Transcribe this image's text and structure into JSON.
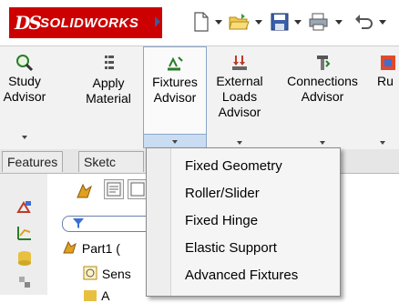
{
  "app": {
    "logo_text": "SOLIDWORKS",
    "logo_mark": "DS"
  },
  "quick_access": [
    {
      "icon": "new-document-icon"
    },
    {
      "icon": "open-folder-icon"
    },
    {
      "icon": "save-icon"
    },
    {
      "icon": "print-icon"
    }
  ],
  "ribbon": {
    "buttons": [
      {
        "icon": "study-advisor-icon",
        "line1": "Study",
        "line2": "Advisor",
        "line3": ""
      },
      {
        "icon": "apply-material-icon",
        "line1": "Apply",
        "line2": "Material",
        "line3": ""
      },
      {
        "icon": "fixtures-advisor-icon",
        "line1": "Fixtures",
        "line2": "Advisor",
        "line3": ""
      },
      {
        "icon": "external-loads-icon",
        "line1": "External",
        "line2": "Loads",
        "line3": "Advisor"
      },
      {
        "icon": "connections-advisor-icon",
        "line1": "Connections",
        "line2": "Advisor",
        "line3": ""
      },
      {
        "icon": "run-icon",
        "line1": "Ru",
        "line2": "",
        "line3": ""
      }
    ]
  },
  "tabs": [
    {
      "label": "Features"
    },
    {
      "label": "Sketc"
    }
  ],
  "tree": {
    "part_label": "Part1  (",
    "sensors_label": "Sens",
    "next_label": "A"
  },
  "menu": {
    "items": [
      {
        "label": "Fixed Geometry"
      },
      {
        "label": "Roller/Slider"
      },
      {
        "label": "Fixed Hinge"
      },
      {
        "label": "Elastic Support"
      },
      {
        "label": "Advanced Fixtures"
      }
    ]
  },
  "colors": {
    "brand": "#cc0000",
    "ribbon_bg": "#f2f2f2",
    "active_border": "#8aa6c8",
    "active_drop": "#c9dcf2"
  }
}
